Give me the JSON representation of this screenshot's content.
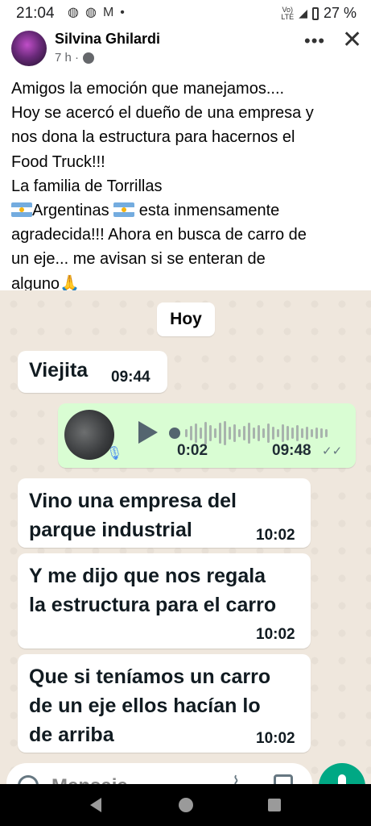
{
  "status_bar": {
    "time": "21:04",
    "left_icons": [
      "shell-icon",
      "shell-icon",
      "gmail-icon",
      "dot-icon"
    ],
    "network_label": "Vo)) LTE",
    "battery_percent": "27 %"
  },
  "post": {
    "author": "Silvina Ghilardi",
    "time_ago": "7 h ·",
    "caption_lines": [
      "Amigos la emoción que manejamos....",
      "Hoy se acercó  el dueño de una empresa y",
      "nos dona la estructura  para hacernos  el",
      "Food Truck!!!",
      "La familia de Torrillas",
      "Argentinas",
      "esta inmensamente",
      "agradecida!!!  Ahora en busca de carro de",
      "un eje... me avisan si se enteran de",
      "alguno"
    ],
    "prayer_emoji": "🙏"
  },
  "chat": {
    "date_chip": "Hoy",
    "messages": [
      {
        "text": "Viejita",
        "time": "09:44"
      },
      {
        "text_lines": [
          "Vino una empresa del",
          "parque industrial"
        ],
        "time": "10:02"
      },
      {
        "text_lines": [
          "Y me dijo que nos regala",
          "la estructura para el carro"
        ],
        "time": "10:02"
      },
      {
        "text_lines": [
          "Que si teníamos un carro",
          "de un eje ellos hacían lo",
          "de arriba"
        ],
        "time": "10:02"
      }
    ],
    "voice_note": {
      "current": "0:02",
      "time": "09:48",
      "ticks": "✓✓"
    },
    "input_placeholder": "Mensaje"
  },
  "colors": {
    "chat_background": "#efe7dd",
    "outgoing_bubble": "#d9fdd3",
    "incoming_bubble": "#ffffff",
    "whatsapp_green": "#00a884"
  }
}
